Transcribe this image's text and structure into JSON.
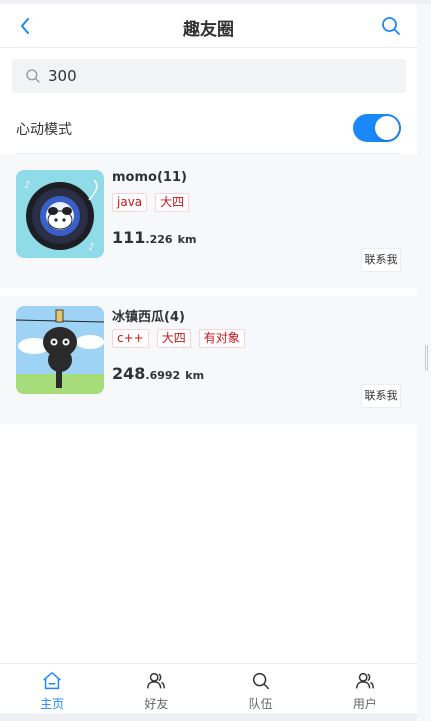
{
  "navbar": {
    "title": "趣友圈"
  },
  "search": {
    "value": "300"
  },
  "mode": {
    "label": "心动模式",
    "enabled": true
  },
  "users": [
    {
      "name": "momo(11)",
      "tags": [
        "java",
        "大四"
      ],
      "distance_int": "111",
      "distance_dec": ".226",
      "unit": "km",
      "contact_label": "联系我"
    },
    {
      "name": "冰镇西瓜(4)",
      "tags": [
        "c++",
        "大四",
        "有对象"
      ],
      "distance_int": "248",
      "distance_dec": ".6992",
      "unit": "km",
      "contact_label": "联系我"
    }
  ],
  "tabbar": {
    "items": [
      {
        "label": "主页",
        "icon": "home-icon",
        "active": true
      },
      {
        "label": "好友",
        "icon": "friends-icon",
        "active": false
      },
      {
        "label": "队伍",
        "icon": "search-icon",
        "active": false
      },
      {
        "label": "用户",
        "icon": "user-icon",
        "active": false
      }
    ]
  },
  "colors": {
    "accent": "#1989fa",
    "tag_text": "#c8161d"
  }
}
